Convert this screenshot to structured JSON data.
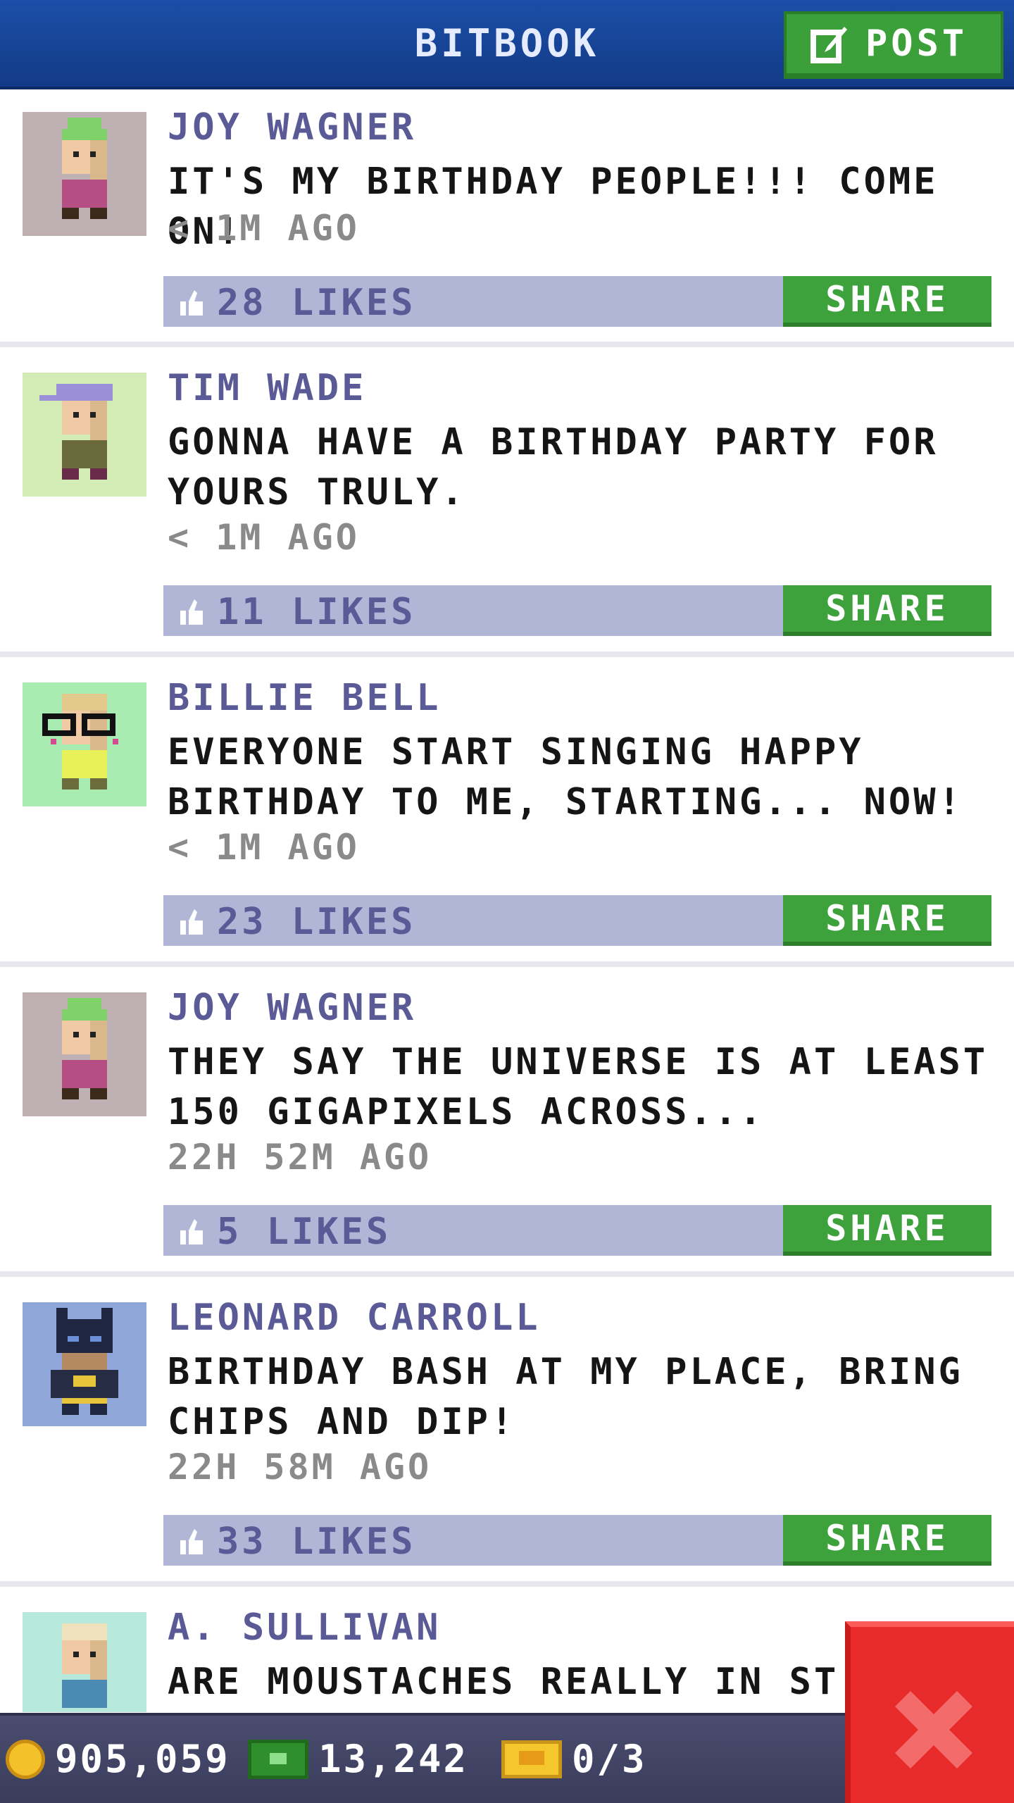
{
  "header": {
    "title": "BITBOOK",
    "post_label": "POST"
  },
  "posts": [
    {
      "name": "JOY WAGNER",
      "text": "IT'S MY BIRTHDAY PEOPLE!!! COME ON!",
      "time": "< 1M AGO",
      "likes": "28 LIKES",
      "share": "SHARE",
      "avatar_icon": "bitizen-green-hat-icon"
    },
    {
      "name": "TIM WADE",
      "text": "GONNA HAVE A BIRTHDAY PARTY FOR YOURS TRULY.",
      "time": "< 1M AGO",
      "likes": "11 LIKES",
      "share": "SHARE",
      "avatar_icon": "bitizen-purple-cap-icon"
    },
    {
      "name": "BILLIE BELL",
      "text": "EVERYONE START SINGING HAPPY BIRTHDAY TO ME, STARTING... NOW!",
      "time": "< 1M AGO",
      "likes": "23 LIKES",
      "share": "SHARE",
      "avatar_icon": "bitizen-glasses-icon"
    },
    {
      "name": "JOY WAGNER",
      "text": "THEY SAY THE UNIVERSE IS AT LEAST 150 GIGAPIXELS ACROSS...",
      "time": "22H 52M AGO",
      "likes": "5 LIKES",
      "share": "SHARE",
      "avatar_icon": "bitizen-green-hat-icon"
    },
    {
      "name": "LEONARD CARROLL",
      "text": "BIRTHDAY BASH AT MY PLACE, BRING CHIPS AND DIP!",
      "time": "22H 58M AGO",
      "likes": "33 LIKES",
      "share": "SHARE",
      "avatar_icon": "bitizen-bat-costume-icon"
    },
    {
      "name": "A. SULLIVAN",
      "text": "ARE MOUSTACHES REALLY IN ST",
      "avatar_icon": "bitizen-blond-icon"
    }
  ],
  "bottom_bar": {
    "coins": "905,059",
    "bux": "13,242",
    "tickets": "0/3"
  },
  "colors": {
    "header": "#1b4fa8",
    "accent_green": "#3ea23c",
    "likes_bar": "#b2b6d6",
    "close_red": "#e82a2a"
  }
}
